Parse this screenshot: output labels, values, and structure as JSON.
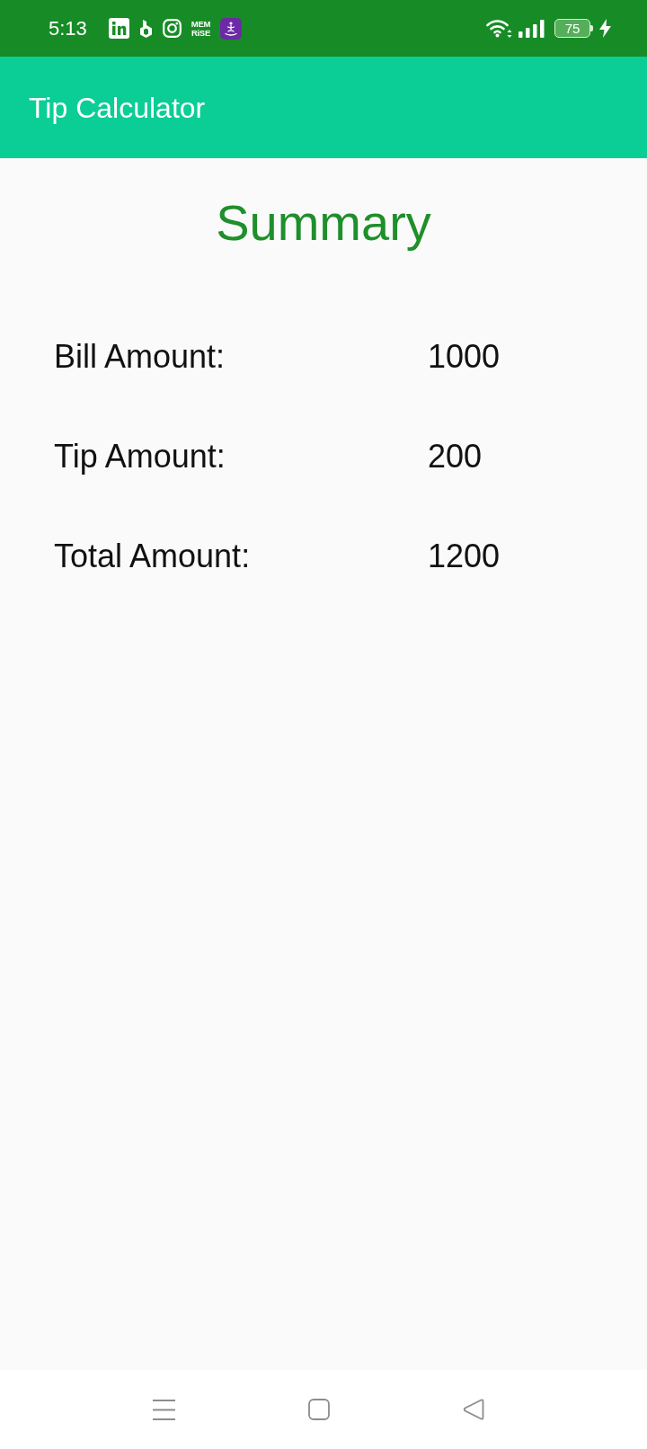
{
  "status_bar": {
    "time": "5:13",
    "app_logo_lines": [
      "MEM",
      "RiSE"
    ],
    "battery": "75"
  },
  "app_bar": {
    "title": "Tip Calculator"
  },
  "summary": {
    "title": "Summary",
    "rows": [
      {
        "label": "Bill Amount:",
        "value": "1000"
      },
      {
        "label": "Tip Amount:",
        "value": "200"
      },
      {
        "label": "Total Amount:",
        "value": "1200"
      }
    ]
  }
}
